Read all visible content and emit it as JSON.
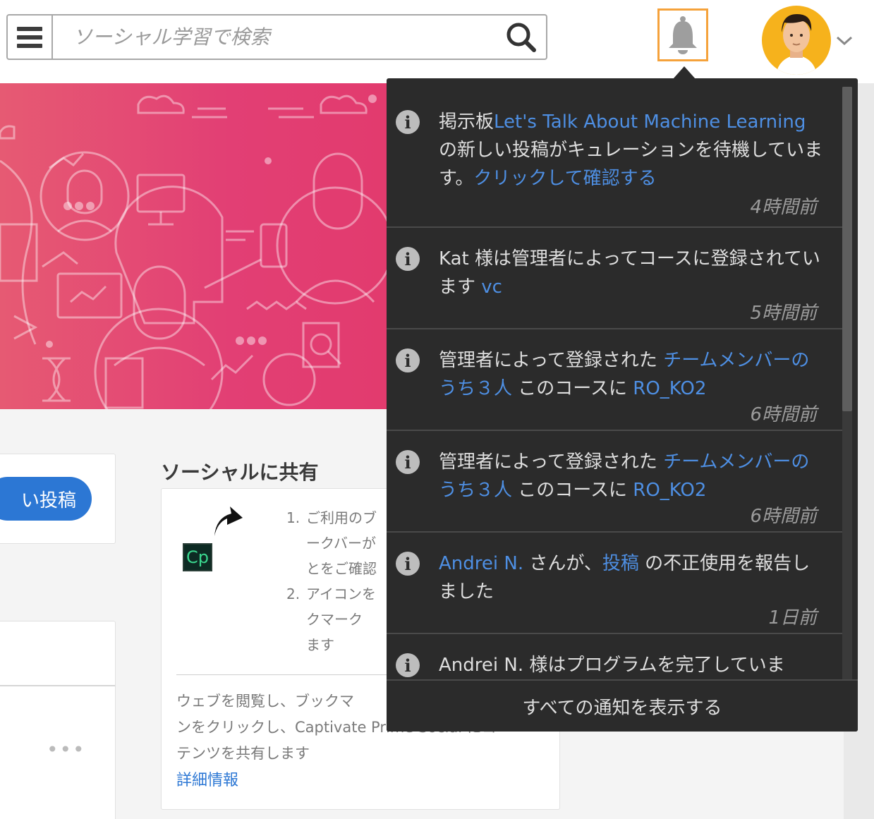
{
  "header": {
    "search_placeholder": "ソーシャル学習で検索"
  },
  "colors": {
    "accent": "#2c77d4",
    "bell_highlight": "#f5a23b",
    "banner": "#e23f74",
    "panel_bg": "#2b2b2b",
    "link": "#4e8fe3"
  },
  "icons": [
    "hamburger-menu-icon",
    "search-icon",
    "bell-icon",
    "chevron-down-icon",
    "info-icon",
    "share-arrow-icon"
  ],
  "left_column": {
    "post_button_label": "い投稿",
    "more_label": "•••"
  },
  "share": {
    "title": "ソーシャルに共有",
    "app_icon_label": "Cp",
    "steps": [
      {
        "num": "1.",
        "text": "ご利用のブ\nークバーが\nとをご確認"
      },
      {
        "num": "2.",
        "text": "アイコンを\nクマーク\nます"
      }
    ],
    "description": "ウェブを閲覧し、ブックマ\nンをクリックし、Captivate Prime Social にコ\nテンツを共有します",
    "more_info_link": "詳細情報"
  },
  "notifications": {
    "items": [
      {
        "parts": [
          {
            "t": "掲示板",
            "link": false
          },
          {
            "t": "Let's Talk About Machine Learning",
            "link": true
          },
          {
            "t": "の新しい投稿がキュレーションを待機しています。",
            "link": false
          },
          {
            "t": "クリックして確認する",
            "link": true
          }
        ],
        "time": "4時間前"
      },
      {
        "parts": [
          {
            "t": "Kat 様は管理者によってコースに登録されています ",
            "link": false
          },
          {
            "t": "vc",
            "link": true
          }
        ],
        "time": "5時間前"
      },
      {
        "parts": [
          {
            "t": "管理者によって登録された ",
            "link": false
          },
          {
            "t": "チームメンバーのうち３人",
            "link": true
          },
          {
            "t": " このコースに ",
            "link": false
          },
          {
            "t": "RO_KO2",
            "link": true
          }
        ],
        "time": "6時間前"
      },
      {
        "parts": [
          {
            "t": "管理者によって登録された ",
            "link": false
          },
          {
            "t": "チームメンバーのうち３人",
            "link": true
          },
          {
            "t": " このコースに ",
            "link": false
          },
          {
            "t": "RO_KO2",
            "link": true
          }
        ],
        "time": "6時間前"
      },
      {
        "parts": [
          {
            "t": "Andrei N.",
            "link": true
          },
          {
            "t": " さんが、",
            "link": false
          },
          {
            "t": "投稿",
            "link": true
          },
          {
            "t": " の不正使用を報告しました",
            "link": false
          }
        ],
        "time": "1日前"
      },
      {
        "parts": [
          {
            "t": "Andrei N. 様はプログラムを完了していま",
            "link": false
          }
        ],
        "time": ""
      }
    ],
    "view_all_label": "すべての通知を表示する"
  }
}
